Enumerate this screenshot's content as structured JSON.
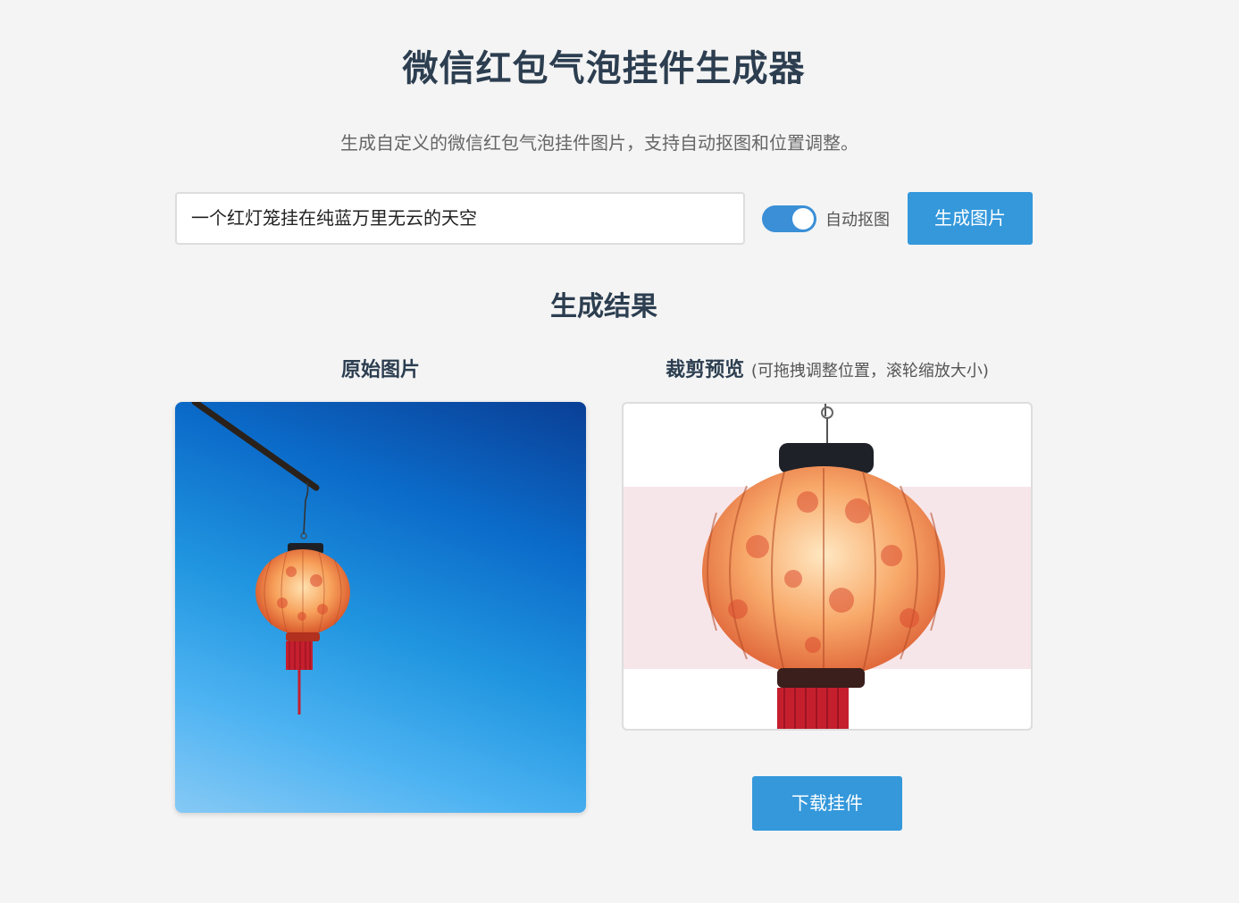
{
  "header": {
    "title": "微信红包气泡挂件生成器",
    "subtitle": "生成自定义的微信红包气泡挂件图片，支持自动抠图和位置调整。"
  },
  "form": {
    "prompt_value": "一个红灯笼挂在纯蓝万里无云的天空",
    "auto_cutout_label": "自动抠图",
    "auto_cutout_enabled": true,
    "generate_button": "生成图片"
  },
  "result": {
    "title": "生成结果",
    "original_heading": "原始图片",
    "crop_heading": "裁剪预览",
    "crop_hint": "(可拖拽调整位置，滚轮缩放大小)",
    "download_button": "下载挂件"
  },
  "colors": {
    "accent": "#3498db",
    "title": "#2c3e50",
    "background": "#f4f4f4",
    "bubble_band": "#f7e6e9"
  }
}
